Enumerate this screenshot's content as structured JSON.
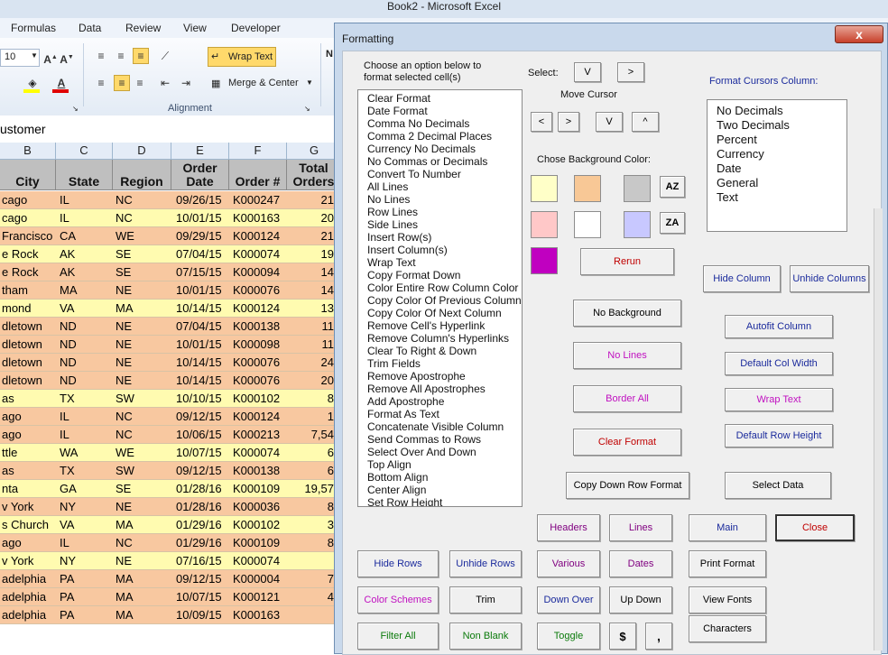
{
  "window": {
    "title": "Book2 - Microsoft Excel"
  },
  "ribbon": {
    "tabs": [
      "Formulas",
      "Data",
      "Review",
      "View",
      "Developer"
    ],
    "font_size": "10",
    "wrap_text": "Wrap Text",
    "merge_center": "Merge & Center",
    "group_alignment": "Alignment"
  },
  "formula_bar": {
    "value": "ustomer"
  },
  "sheet": {
    "columns": [
      "B",
      "C",
      "D",
      "E",
      "F",
      "G"
    ],
    "headers": [
      "City",
      "State",
      "Region",
      "Order Date",
      "Order #",
      "Total Orders"
    ],
    "rows": [
      {
        "city": "cago",
        "state": "IL",
        "region": "NC",
        "date": "09/26/15",
        "order": "K000247",
        "total": "21",
        "color": "#f8c8a0"
      },
      {
        "city": "cago",
        "state": "IL",
        "region": "NC",
        "date": "10/01/15",
        "order": "K000163",
        "total": "20",
        "color": "#fffbb0"
      },
      {
        "city": "Francisco",
        "state": "CA",
        "region": "WE",
        "date": "09/29/15",
        "order": "K000124",
        "total": "21",
        "color": "#f8c8a0"
      },
      {
        "city": "e Rock",
        "state": "AK",
        "region": "SE",
        "date": "07/04/15",
        "order": "K000074",
        "total": "19",
        "color": "#fffbb0"
      },
      {
        "city": "e Rock",
        "state": "AK",
        "region": "SE",
        "date": "07/15/15",
        "order": "K000094",
        "total": "14",
        "color": "#f8c8a0"
      },
      {
        "city": "tham",
        "state": "MA",
        "region": "NE",
        "date": "10/01/15",
        "order": "K000076",
        "total": "14",
        "color": "#f8c8a0"
      },
      {
        "city": "mond",
        "state": "VA",
        "region": "MA",
        "date": "10/14/15",
        "order": "K000124",
        "total": "13",
        "color": "#fffbb0"
      },
      {
        "city": "dletown",
        "state": "ND",
        "region": "NE",
        "date": "07/04/15",
        "order": "K000138",
        "total": "11",
        "color": "#f8c8a0"
      },
      {
        "city": "dletown",
        "state": "ND",
        "region": "NE",
        "date": "10/01/15",
        "order": "K000098",
        "total": "11",
        "color": "#f8c8a0"
      },
      {
        "city": "dletown",
        "state": "ND",
        "region": "NE",
        "date": "10/14/15",
        "order": "K000076",
        "total": "24",
        "color": "#f8c8a0"
      },
      {
        "city": "dletown",
        "state": "ND",
        "region": "NE",
        "date": "10/14/15",
        "order": "K000076",
        "total": "20",
        "color": "#f8c8a0"
      },
      {
        "city": "as",
        "state": "TX",
        "region": "SW",
        "date": "10/10/15",
        "order": "K000102",
        "total": "8",
        "color": "#fffbb0"
      },
      {
        "city": "ago",
        "state": "IL",
        "region": "NC",
        "date": "09/12/15",
        "order": "K000124",
        "total": "1",
        "color": "#f8c8a0"
      },
      {
        "city": "ago",
        "state": "IL",
        "region": "NC",
        "date": "10/06/15",
        "order": "K000213",
        "total": "7,54",
        "color": "#f8c8a0"
      },
      {
        "city": "ttle",
        "state": "WA",
        "region": "WE",
        "date": "10/07/15",
        "order": "K000074",
        "total": "6",
        "color": "#fffbb0"
      },
      {
        "city": "as",
        "state": "TX",
        "region": "SW",
        "date": "09/12/15",
        "order": "K000138",
        "total": "6",
        "color": "#f8c8a0"
      },
      {
        "city": "nta",
        "state": "GA",
        "region": "SE",
        "date": "01/28/16",
        "order": "K000109",
        "total": "19,57",
        "color": "#fffbb0"
      },
      {
        "city": "v York",
        "state": "NY",
        "region": "NE",
        "date": "01/28/16",
        "order": "K000036",
        "total": "8",
        "color": "#f8c8a0"
      },
      {
        "city": "s Church",
        "state": "VA",
        "region": "MA",
        "date": "01/29/16",
        "order": "K000102",
        "total": "3",
        "color": "#fffbb0"
      },
      {
        "city": "ago",
        "state": "IL",
        "region": "NC",
        "date": "01/29/16",
        "order": "K000109",
        "total": "8",
        "color": "#f8c8a0"
      },
      {
        "city": "v York",
        "state": "NY",
        "region": "NE",
        "date": "07/16/15",
        "order": "K000074",
        "total": "",
        "color": "#fffbb0"
      },
      {
        "city": "adelphia",
        "state": "PA",
        "region": "MA",
        "date": "09/12/15",
        "order": "K000004",
        "total": "7",
        "color": "#f8c8a0"
      },
      {
        "city": "adelphia",
        "state": "PA",
        "region": "MA",
        "date": "10/07/15",
        "order": "K000121",
        "total": "4",
        "color": "#f8c8a0"
      },
      {
        "city": "adelphia",
        "state": "PA",
        "region": "MA",
        "date": "10/09/15",
        "order": "K000163",
        "total": "",
        "color": "#f8c8a0"
      }
    ]
  },
  "dialog": {
    "title": "Formatting",
    "close_glyph": "x",
    "instructions": "Choose an option below to format selected cell(s)",
    "options": [
      "Clear Format",
      "Date Format",
      "Comma No Decimals",
      "Comma 2 Decimal Places",
      "Currency No Decimals",
      "No Commas or Decimals",
      "Convert To Number",
      "All Lines",
      "No Lines",
      "Row Lines",
      "Side Lines",
      "Insert Row(s)",
      "Insert Column(s)",
      "Wrap Text",
      "Copy Format Down",
      "Color Entire Row Column Color",
      "Copy Color Of Previous Column",
      "Copy Color Of Next Column",
      "Remove Cell's Hyperlink",
      "Remove Column's Hyperlinks",
      "Clear To Right & Down",
      "Trim Fields",
      "Remove Apostrophe",
      "Remove All Apostrophes",
      "Add Apostrophe",
      "Format As Text",
      "Concatenate Visible Column",
      "Send Commas to Rows",
      "Select Over And Down",
      "Top Align",
      "Bottom Align",
      "Center Align",
      "Set Row Height"
    ],
    "select_label": "Select:",
    "select_down": "V",
    "select_right": ">",
    "move_cursor_label": "Move Cursor",
    "move_left": "<",
    "move_right": ">",
    "move_down": "V",
    "move_up": "^",
    "bg_color_label": "Chose Background Color:",
    "swatches": [
      "#ffffc8",
      "#f8c896",
      "#c8c8c8",
      "#ffc8c8",
      "#ffffff",
      "#c8c8ff",
      "#c000c0"
    ],
    "sort_az": "AZ",
    "sort_za": "ZA",
    "rerun": "Rerun",
    "no_background": "No Background",
    "no_lines": "No Lines",
    "border_all": "Border All",
    "clear_format": "Clear Format",
    "copy_down_row_format": "Copy Down Row Format",
    "format_cursors_label": "Format Cursors Column:",
    "cursor_formats": [
      "No Decimals",
      "Two Decimals",
      "Percent",
      "Currency",
      "Date",
      "General",
      "Text"
    ],
    "hide_column": "Hide Column",
    "unhide_columns": "Unhide Columns",
    "autofit_column": "Autofit Column",
    "default_col_width": "Default Col Width",
    "wrap_text": "Wrap Text",
    "default_row_height": "Default Row Height",
    "select_data": "Select Data",
    "headers": "Headers",
    "lines": "Lines",
    "main": "Main",
    "close": "Close",
    "hide_rows": "Hide Rows",
    "unhide_rows": "Unhide Rows",
    "various": "Various",
    "dates": "Dates",
    "print_format": "Print Format",
    "color_schemes": "Color Schemes",
    "trim": "Trim",
    "down_over": "Down Over",
    "up_down": "Up Down",
    "view_fonts": "View Fonts",
    "filter_all": "Filter All",
    "non_blank": "Non Blank",
    "toggle": "Toggle",
    "dollar": "$",
    "comma": ",",
    "characters": "Characters",
    "colors": {
      "blue": "#1f1fa0",
      "magenta": "#c010c0",
      "red": "#c00000",
      "green": "#0a7a0a",
      "purple": "#800080",
      "navy": "#1a2a9c"
    }
  }
}
